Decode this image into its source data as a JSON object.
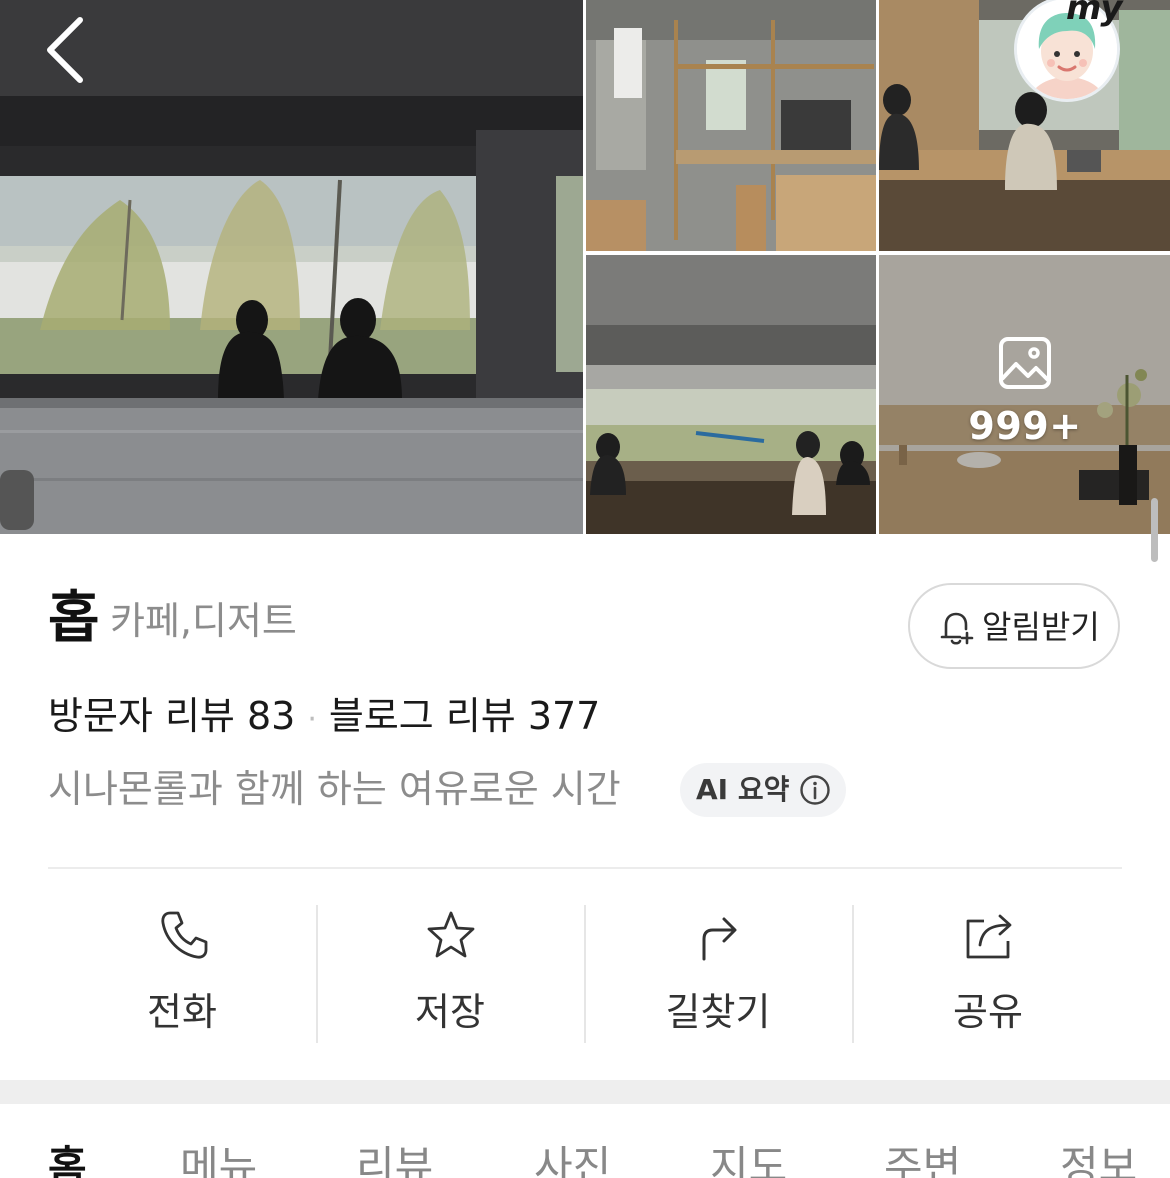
{
  "gallery": {
    "more_count": "999+",
    "my_label": "my"
  },
  "place": {
    "name": "홉",
    "category": "카페,디저트",
    "notify_label": "알림받기",
    "visitor_reviews": "방문자 리뷰 83",
    "blog_reviews": "블로그 리뷰 377",
    "separator": "·",
    "tagline": "시나몬롤과 함께 하는 여유로운 시간",
    "ai_summary_label": "AI 요약"
  },
  "actions": [
    {
      "label": "전화",
      "icon": "phone-icon"
    },
    {
      "label": "저장",
      "icon": "star-icon"
    },
    {
      "label": "길찾기",
      "icon": "directions-icon"
    },
    {
      "label": "공유",
      "icon": "share-icon"
    }
  ],
  "tabs": [
    {
      "label": "홈",
      "active": true
    },
    {
      "label": "메뉴"
    },
    {
      "label": "리뷰"
    },
    {
      "label": "사진"
    },
    {
      "label": "지도"
    },
    {
      "label": "주변"
    },
    {
      "label": "정보"
    }
  ]
}
